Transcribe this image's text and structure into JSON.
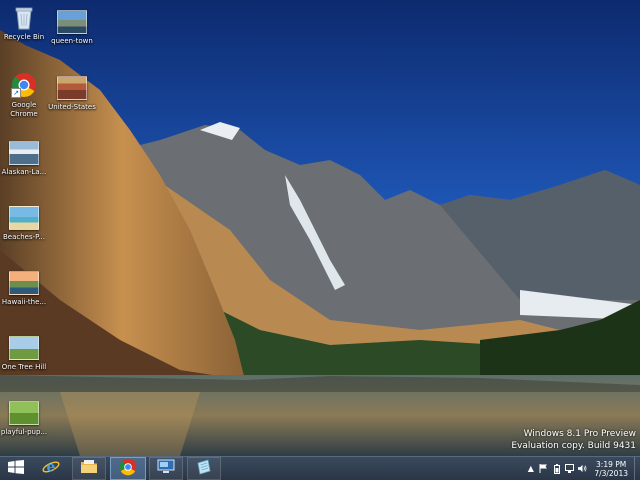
{
  "desktop": {
    "icons": [
      {
        "label": "Recycle Bin",
        "icon": "recycle-bin-icon"
      },
      {
        "label": "queen-town",
        "icon": "image-file-icon"
      },
      {
        "label": "Google\nChrome",
        "icon": "chrome-icon"
      },
      {
        "label": "United-States",
        "icon": "image-file-icon"
      },
      {
        "label": "Alaskan-La...",
        "icon": "image-file-icon"
      },
      {
        "label": "Beaches-P...",
        "icon": "image-file-icon"
      },
      {
        "label": "Hawaii-the...",
        "icon": "image-file-icon"
      },
      {
        "label": "One Tree Hill",
        "icon": "image-file-icon"
      },
      {
        "label": "playful-pup...",
        "icon": "image-file-icon"
      }
    ]
  },
  "watermark": {
    "line1": "Windows 8.1 Pro Preview",
    "line2": "Evaluation copy. Build 9431"
  },
  "taskbar": {
    "start": "windows-logo-icon",
    "pinned": [
      "internet-explorer-icon",
      "file-explorer-icon",
      "chrome-icon",
      "remote-desktop-icon",
      "notepad-icon"
    ],
    "active_item": "chrome-icon",
    "accent": "#2a3646",
    "tray": {
      "icons": [
        "show-hidden-chevron-icon",
        "action-center-flag-icon",
        "battery-icon",
        "network-icon",
        "volume-icon"
      ],
      "time": "3:19 PM",
      "date": "7/3/2013"
    }
  }
}
